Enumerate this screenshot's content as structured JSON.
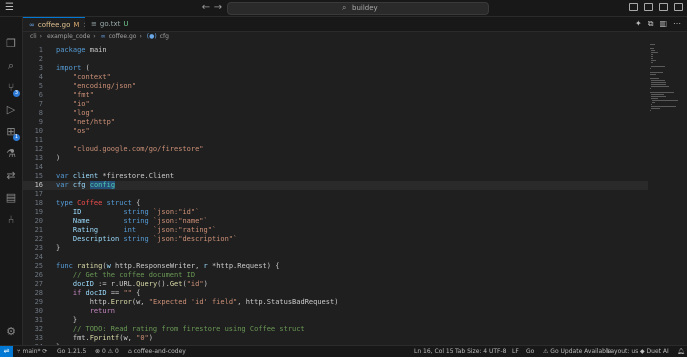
{
  "titlebar": {
    "search_placeholder": "buildey"
  },
  "tabs": [
    {
      "label": "coffee.go",
      "status": "M"
    },
    {
      "label": "go.txt",
      "status": "U"
    }
  ],
  "breadcrumb": [
    "cli",
    "example_code",
    "coffee.go",
    "cfg"
  ],
  "code_lines": [
    {
      "n": "1",
      "html": "<span class=\"kw\">package</span> <span class=\"plain\">main</span>"
    },
    {
      "n": "2",
      "html": ""
    },
    {
      "n": "3",
      "html": "<span class=\"kw\">import</span> <span class=\"plain\">(</span>"
    },
    {
      "n": "4",
      "html": "    <span class=\"str\">\"context\"</span>"
    },
    {
      "n": "5",
      "html": "    <span class=\"str\">\"encoding/json\"</span>"
    },
    {
      "n": "6",
      "html": "    <span class=\"str\">\"fmt\"</span>"
    },
    {
      "n": "7",
      "html": "    <span class=\"str\">\"io\"</span>"
    },
    {
      "n": "8",
      "html": "    <span class=\"str\">\"log\"</span>"
    },
    {
      "n": "9",
      "html": "    <span class=\"str\">\"net/http\"</span>"
    },
    {
      "n": "10",
      "html": "    <span class=\"str\">\"os\"</span>"
    },
    {
      "n": "11",
      "html": ""
    },
    {
      "n": "12",
      "html": "    <span class=\"str\">\"cloud.google.com/go/firestore\"</span>"
    },
    {
      "n": "13",
      "html": "<span class=\"plain\">)</span>"
    },
    {
      "n": "14",
      "html": ""
    },
    {
      "n": "15",
      "html": "<span class=\"kw\">var</span> <span class=\"id\">client</span> <span class=\"plain\">*firestore.Client</span>"
    },
    {
      "n": "16",
      "html": "<span class=\"kw\">var</span> <span class=\"id\">cfg</span> <span class=\"ty sel\">config</span>",
      "current": true
    },
    {
      "n": "17",
      "html": ""
    },
    {
      "n": "18",
      "html": "<span class=\"kw\">type</span> <span class=\"ty\" style=\"color:#f14c4c\">Coffee</span> <span class=\"kw\">struct</span> <span class=\"plain\">{</span>"
    },
    {
      "n": "19",
      "html": "    <span class=\"id\">ID</span>          <span class=\"kw\">string</span> <span class=\"str\">`json:\"id\"`</span>"
    },
    {
      "n": "20",
      "html": "    <span class=\"id\">Name</span>        <span class=\"kw\">string</span> <span class=\"str\">`json:\"name\"`</span>"
    },
    {
      "n": "21",
      "html": "    <span class=\"id\">Rating</span>      <span class=\"kw\">int</span>    <span class=\"str\">`json:\"rating\"`</span>"
    },
    {
      "n": "22",
      "html": "    <span class=\"id\">Description</span> <span class=\"kw\">string</span> <span class=\"str\">`json:\"description\"`</span>"
    },
    {
      "n": "23",
      "html": "<span class=\"plain\">}</span>"
    },
    {
      "n": "24",
      "html": ""
    },
    {
      "n": "25",
      "html": "<span class=\"kw\">func</span> <span class=\"fn\">rating</span><span class=\"plain\">(</span><span class=\"id\">w</span> <span class=\"plain\">http.ResponseWriter,</span> <span class=\"id\">r</span> <span class=\"plain\">*http.Request) {</span>"
    },
    {
      "n": "26",
      "html": "    <span class=\"cm\">// Get the coffee document ID</span>"
    },
    {
      "n": "27",
      "html": "    <span class=\"id\">docID</span> <span class=\"plain\">:= r.URL.</span><span class=\"fn\">Query</span><span class=\"plain\">().</span><span class=\"fn\">Get</span><span class=\"plain\">(</span><span class=\"str\">\"id\"</span><span class=\"plain\">)</span>"
    },
    {
      "n": "28",
      "html": "    <span class=\"kw2\">if</span> <span class=\"id\">docID</span> <span class=\"plain\">==</span> <span class=\"str\">\"\"</span> <span class=\"plain\">{</span>"
    },
    {
      "n": "29",
      "html": "        <span class=\"plain\">http.</span><span class=\"fn\">Error</span><span class=\"plain\">(w,</span> <span class=\"str\">\"Expected 'id' field\"</span><span class=\"plain\">, http.StatusBadRequest)</span>"
    },
    {
      "n": "30",
      "html": "        <span class=\"kw2\">return</span>"
    },
    {
      "n": "31",
      "html": "    <span class=\"plain\">}</span>"
    },
    {
      "n": "32",
      "html": "    <span class=\"cm\">// TODO: Read rating from firestore using Coffee struct</span>"
    },
    {
      "n": "33",
      "html": "    <span class=\"plain\">fmt.</span><span class=\"fn\">Fprintf</span><span class=\"plain\">(w,</span> <span class=\"str\">\"0\"</span><span class=\"plain\">)</span>"
    },
    {
      "n": "34",
      "html": "<span class=\"plain\">}</span>"
    }
  ],
  "status": {
    "branch": "main*",
    "go_version": "Go 1.21.5",
    "problems": "0 ⚠ 0",
    "workspace": "coffee-and-codey",
    "cursor": "Ln 16, Col 15",
    "tab_size": "Tab Size: 4",
    "encoding": "UTF-8",
    "eol": "LF",
    "language": "Go",
    "update": "Go Update Available",
    "layout": "Layout: us",
    "duet": "Duet AI"
  }
}
